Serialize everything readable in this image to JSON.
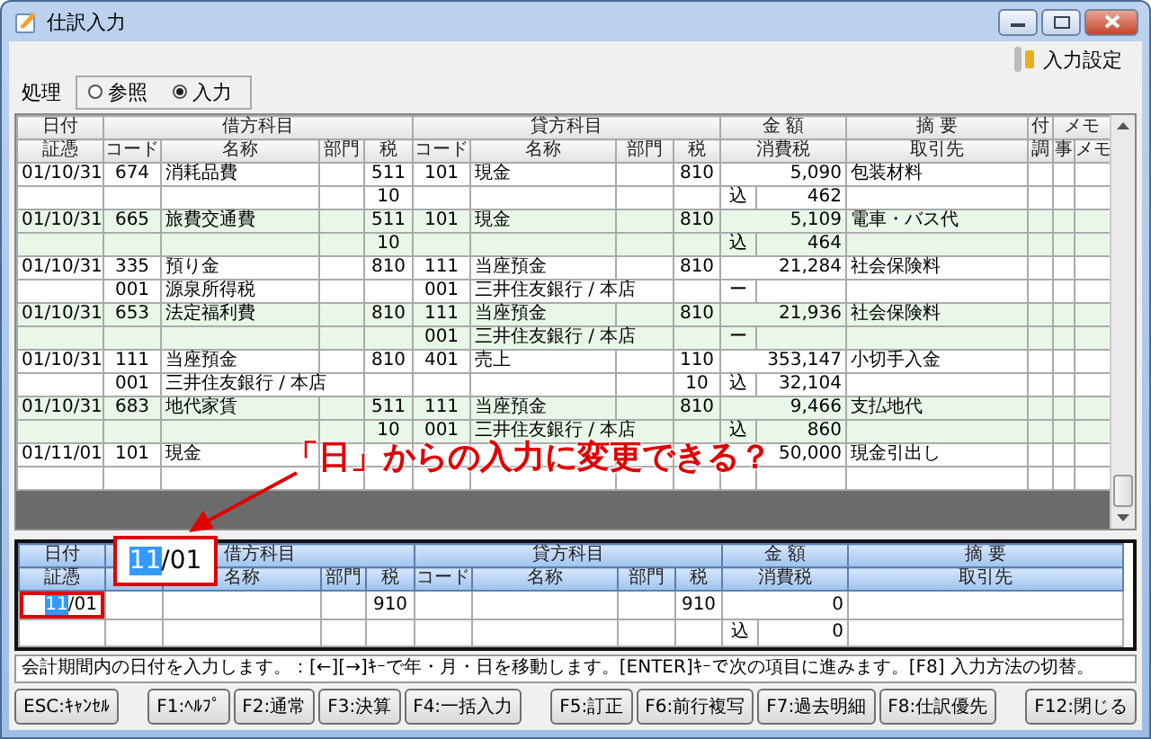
{
  "window": {
    "title": "仕訳入力"
  },
  "settings_button": "入力設定",
  "mode": {
    "label": "処理",
    "options": [
      {
        "label": "参照",
        "selected": false
      },
      {
        "label": "入力",
        "selected": true
      }
    ]
  },
  "journal": {
    "header_top": [
      "日付",
      "借方科目",
      "貸方科目",
      "金 額",
      "摘 要",
      "付",
      "メモ"
    ],
    "header_bottom": [
      "証憑",
      "コード",
      "名称",
      "部門",
      "税",
      "コード",
      "名称",
      "部門",
      "税",
      "消費税",
      "取引先",
      "調",
      "事",
      "メモ"
    ],
    "entries": [
      {
        "lines": [
          {
            "date": "01/10/31",
            "debit_code": "674",
            "debit_name": "消耗品費",
            "debit_tax": "511",
            "credit_code": "101",
            "credit_name": "現金",
            "credit_tax": "810",
            "amount": "5,090",
            "description": "包装材料"
          },
          {
            "debit_tax": "10",
            "tax_type": "込",
            "amount": "462"
          }
        ]
      },
      {
        "lines": [
          {
            "date": "01/10/31",
            "debit_code": "665",
            "debit_name": "旅費交通費",
            "debit_tax": "511",
            "credit_code": "101",
            "credit_name": "現金",
            "credit_tax": "810",
            "amount": "5,109",
            "description": "電車・バス代"
          },
          {
            "debit_tax": "10",
            "tax_type": "込",
            "amount": "464"
          }
        ]
      },
      {
        "lines": [
          {
            "date": "01/10/31",
            "debit_code": "335",
            "debit_name": "預り金",
            "debit_tax": "810",
            "credit_code": "111",
            "credit_name": "当座預金",
            "credit_tax": "810",
            "amount": "21,284",
            "description": "社会保険料"
          },
          {
            "debit_code": "001",
            "debit_name": "源泉所得税",
            "credit_code": "001",
            "credit_name": "三井住友銀行 / 本店",
            "tax_type": "ー"
          }
        ]
      },
      {
        "lines": [
          {
            "date": "01/10/31",
            "debit_code": "653",
            "debit_name": "法定福利費",
            "debit_tax": "810",
            "credit_code": "111",
            "credit_name": "当座預金",
            "credit_tax": "810",
            "amount": "21,936",
            "description": "社会保険料"
          },
          {
            "credit_code": "001",
            "credit_name": "三井住友銀行 / 本店",
            "tax_type": "ー"
          }
        ]
      },
      {
        "lines": [
          {
            "date": "01/10/31",
            "debit_code": "111",
            "debit_name": "当座預金",
            "debit_tax": "810",
            "credit_code": "401",
            "credit_name": "売上",
            "credit_tax": "110",
            "amount": "353,147",
            "description": "小切手入金"
          },
          {
            "debit_code": "001",
            "debit_name": "三井住友銀行 / 本店",
            "credit_tax": "10",
            "tax_type": "込",
            "amount": "32,104"
          }
        ]
      },
      {
        "lines": [
          {
            "date": "01/10/31",
            "debit_code": "683",
            "debit_name": "地代家賃",
            "debit_tax": "511",
            "credit_code": "111",
            "credit_name": "当座預金",
            "credit_tax": "810",
            "amount": "9,466",
            "description": "支払地代"
          },
          {
            "debit_tax": "10",
            "credit_code": "001",
            "credit_name": "三井住友銀行 / 本店",
            "tax_type": "込",
            "amount": "860"
          }
        ]
      },
      {
        "lines": [
          {
            "date": "01/11/01",
            "debit_code": "101",
            "debit_name": "現金",
            "amount": "50,000",
            "description": "現金引出し"
          }
        ]
      }
    ]
  },
  "entry_form": {
    "header_top": [
      "日付",
      "借方科目",
      "貸方科目",
      "金 額",
      "摘 要"
    ],
    "header_bottom": [
      "証憑",
      "名称",
      "部門",
      "税",
      "コード",
      "名称",
      "部門",
      "税",
      "消費税",
      "取引先"
    ],
    "date": {
      "selected_part": "11",
      "rest": "/01"
    },
    "debit_tax": "910",
    "credit_tax": "910",
    "amount": "0",
    "tax_type": "込",
    "tax_amount": "0"
  },
  "annotation": {
    "text": "「日」からの入力に変更できる？",
    "callout": {
      "selected_part": "11",
      "rest": "/01"
    }
  },
  "status_bar": "会計期間内の日付を入力します。：[←][→]ｷｰで年・月・日を移動します。[ENTER]ｷｰで次の項目に進みます。[F8] 入力方法の切替。",
  "function_keys": [
    [
      "ESC:ｷｬﾝｾﾙ"
    ],
    [
      "F1:ﾍﾙﾌﾟ",
      "F2:通常",
      "F3:決算",
      "F4:一括入力"
    ],
    [
      "F5:訂正",
      "F6:前行複写",
      "F7:過去明細",
      "F8:仕訳優先"
    ],
    [
      "F12:閉じる"
    ]
  ]
}
